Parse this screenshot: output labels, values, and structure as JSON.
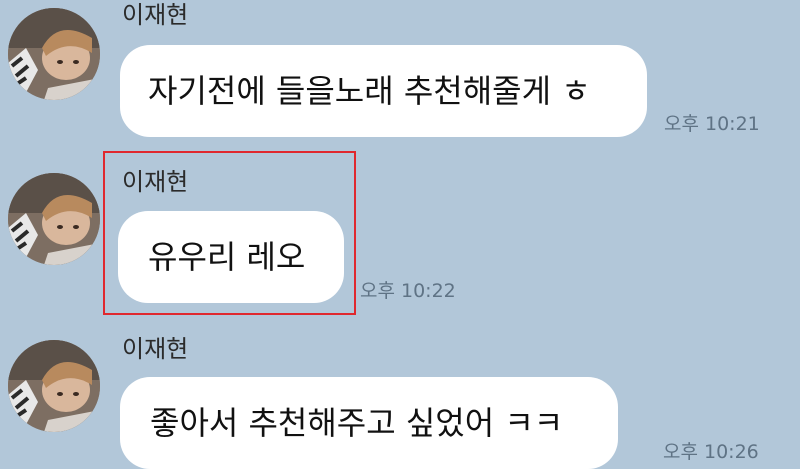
{
  "colors": {
    "background": "#b2c7d9",
    "bubble": "#ffffff",
    "highlight": "#e0282e"
  },
  "messages": [
    {
      "sender": "이재현",
      "text": "자기전에 들을노래 추천해줄게 ㅎ",
      "time": "오후 10:21"
    },
    {
      "sender": "이재현",
      "text": "유우리 레오",
      "time": "오후 10:22"
    },
    {
      "sender": "이재현",
      "text": "좋아서 추천해주고 싶었어 ㅋㅋ",
      "time": "오후 10:26"
    }
  ],
  "icons": {
    "avatar": "profile-photo-icon"
  }
}
